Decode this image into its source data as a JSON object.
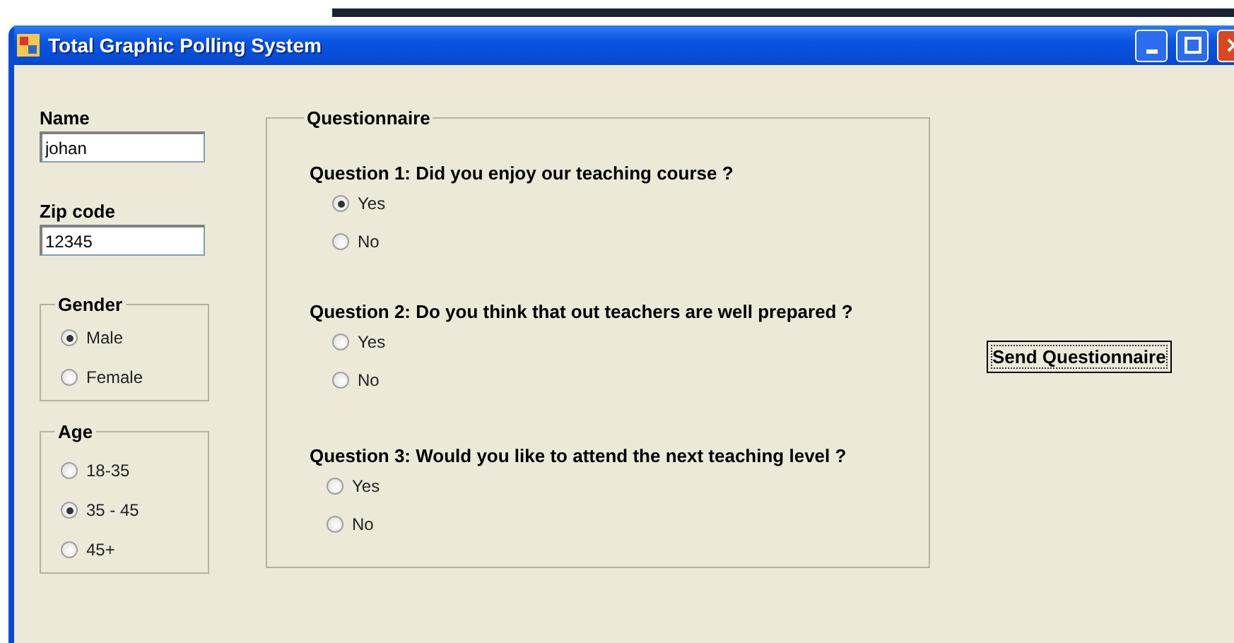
{
  "window": {
    "title": "Total Graphic Polling System"
  },
  "fields": [
    {
      "label": "Name",
      "value": "johan"
    },
    {
      "label": "Zip code",
      "value": "12345"
    }
  ],
  "gender": {
    "title": "Gender",
    "options": [
      {
        "label": "Male",
        "selected": true
      },
      {
        "label": "Female",
        "selected": false
      }
    ]
  },
  "age": {
    "title": "Age",
    "options": [
      {
        "label": "18-35",
        "selected": false
      },
      {
        "label": "35 - 45",
        "selected": true
      },
      {
        "label": "45+",
        "selected": false
      }
    ]
  },
  "questionnaire": {
    "title": "Questionnaire",
    "questions": [
      {
        "text": "Question 1: Did you enjoy our teaching course ?",
        "options": [
          {
            "label": "Yes",
            "selected": true
          },
          {
            "label": "No",
            "selected": false
          }
        ]
      },
      {
        "text": "Question 2: Do you think that out teachers are well prepared ?",
        "options": [
          {
            "label": "Yes",
            "selected": false
          },
          {
            "label": "No",
            "selected": false
          }
        ]
      },
      {
        "text": "Question 3: Would you like to attend the next teaching level ?",
        "options": [
          {
            "label": "Yes",
            "selected": false
          },
          {
            "label": "No",
            "selected": false
          }
        ]
      }
    ]
  },
  "button": {
    "label": "Send Questionnaire"
  }
}
